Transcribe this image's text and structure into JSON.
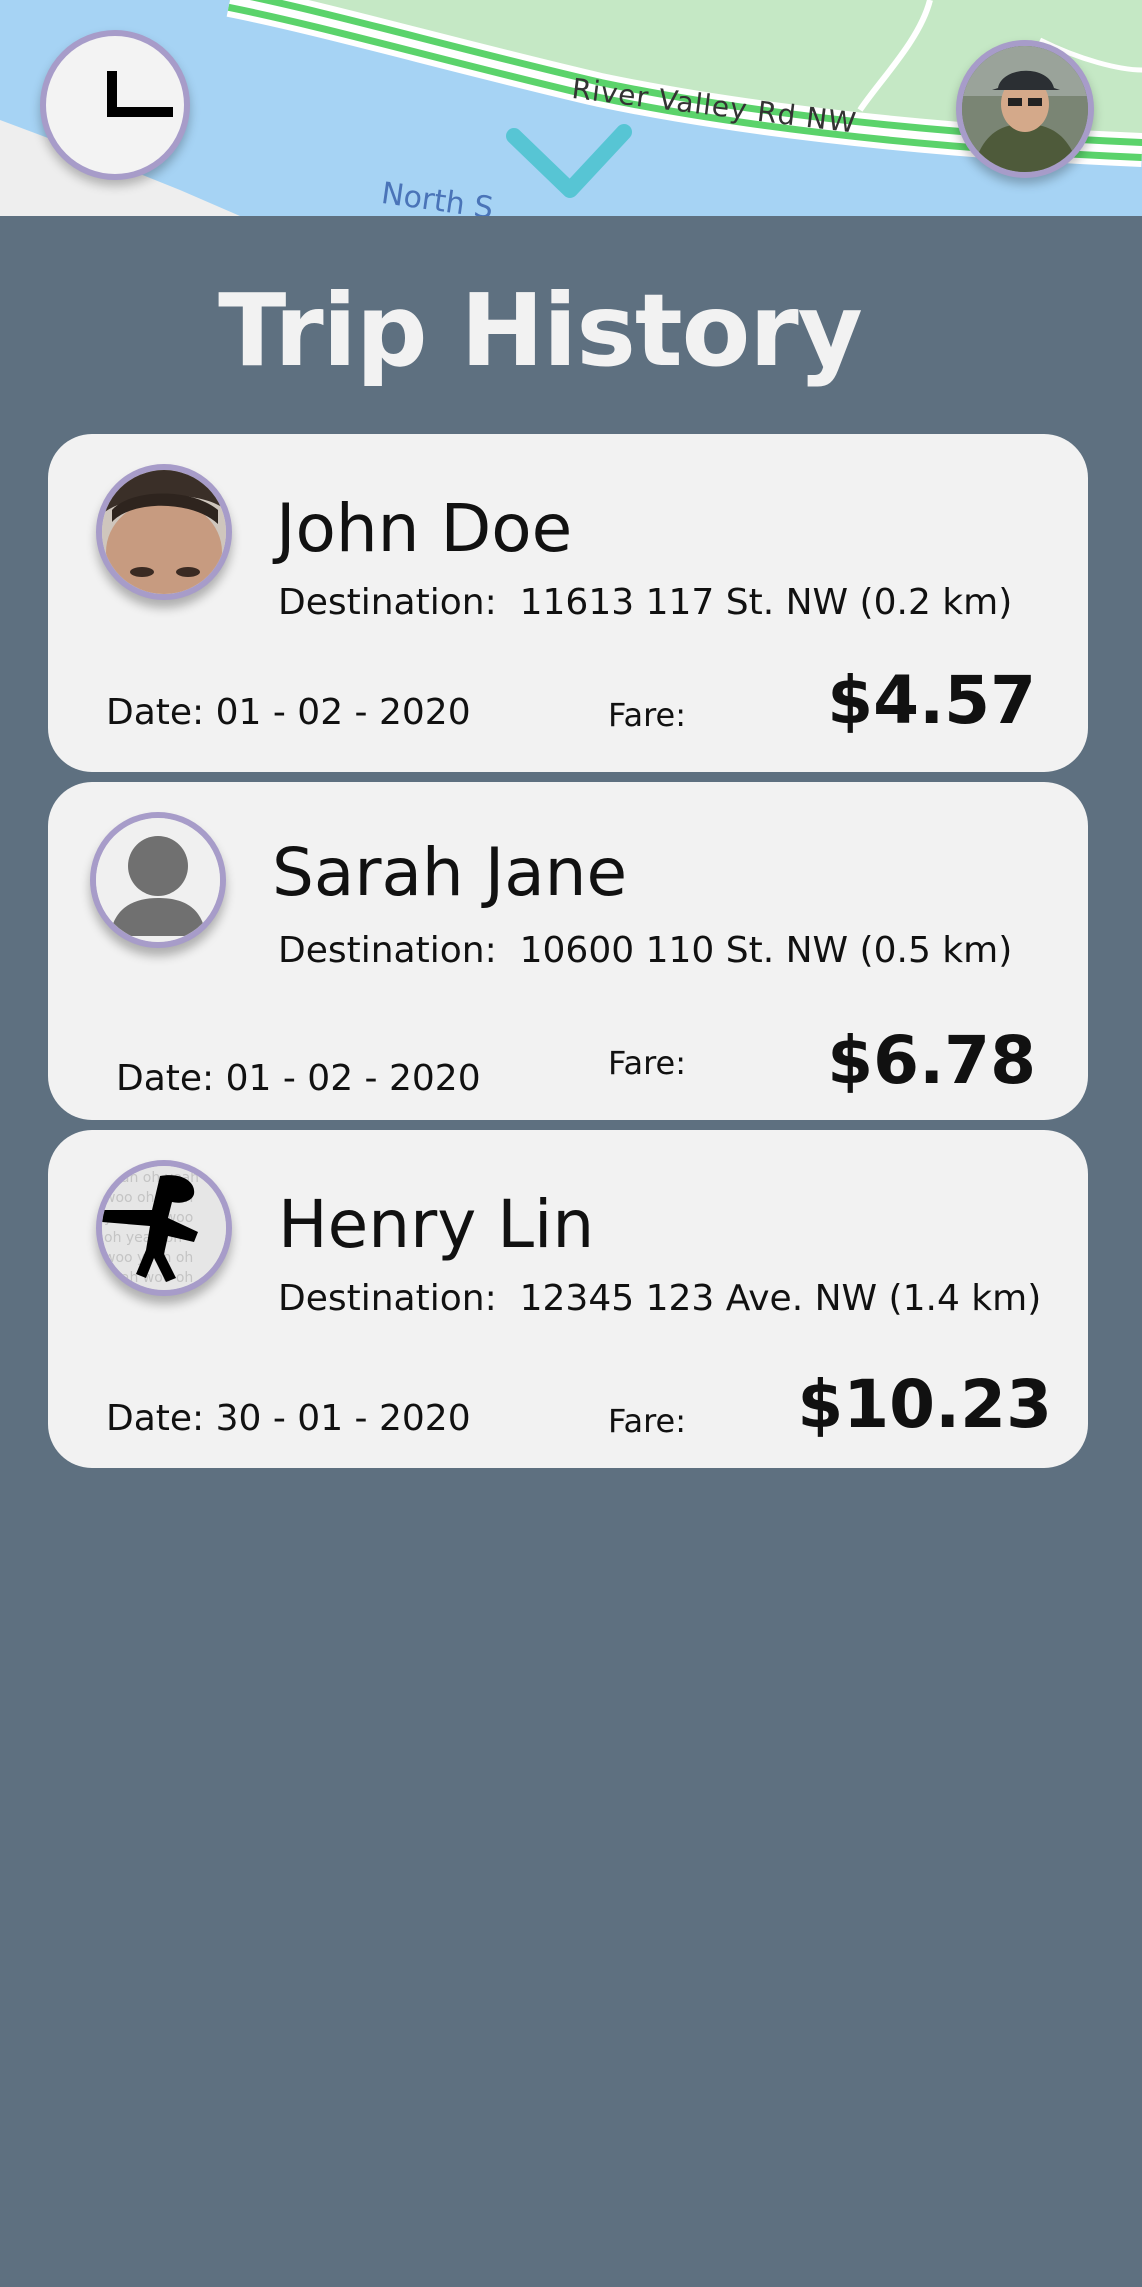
{
  "map": {
    "road_label": "River Valley Rd NW",
    "water_label": "North S"
  },
  "header": {
    "history_icon": "clock-icon",
    "collapse_icon": "chevron-down-icon",
    "profile_icon": "user-avatar"
  },
  "page": {
    "title": "Trip History"
  },
  "trips": [
    {
      "name": "John Doe",
      "destination_label": "Destination:",
      "destination": "11613 117 St. NW (0.2 km)",
      "date": "Date: 01 - 02 - 2020",
      "fare_label": "Fare:",
      "fare": "$4.57"
    },
    {
      "name": "Sarah Jane",
      "destination_label": "Destination:",
      "destination": "10600 110 St. NW (0.5 km)",
      "date": "Date: 01 - 02 - 2020",
      "fare_label": "Fare:",
      "fare": "$6.78"
    },
    {
      "name": "Henry Lin",
      "destination_label": "Destination:",
      "destination": "12345 123 Ave. NW (1.4 km)",
      "date": "Date: 30 - 01 - 2020",
      "fare_label": "Fare:",
      "fare": "$10.23"
    }
  ],
  "colors": {
    "background": "#5e7080",
    "card": "#f2f2f2",
    "avatar_ring": "#a79cc9",
    "accent_chevron": "#4fc3d0",
    "road_green": "#5bd36b"
  }
}
